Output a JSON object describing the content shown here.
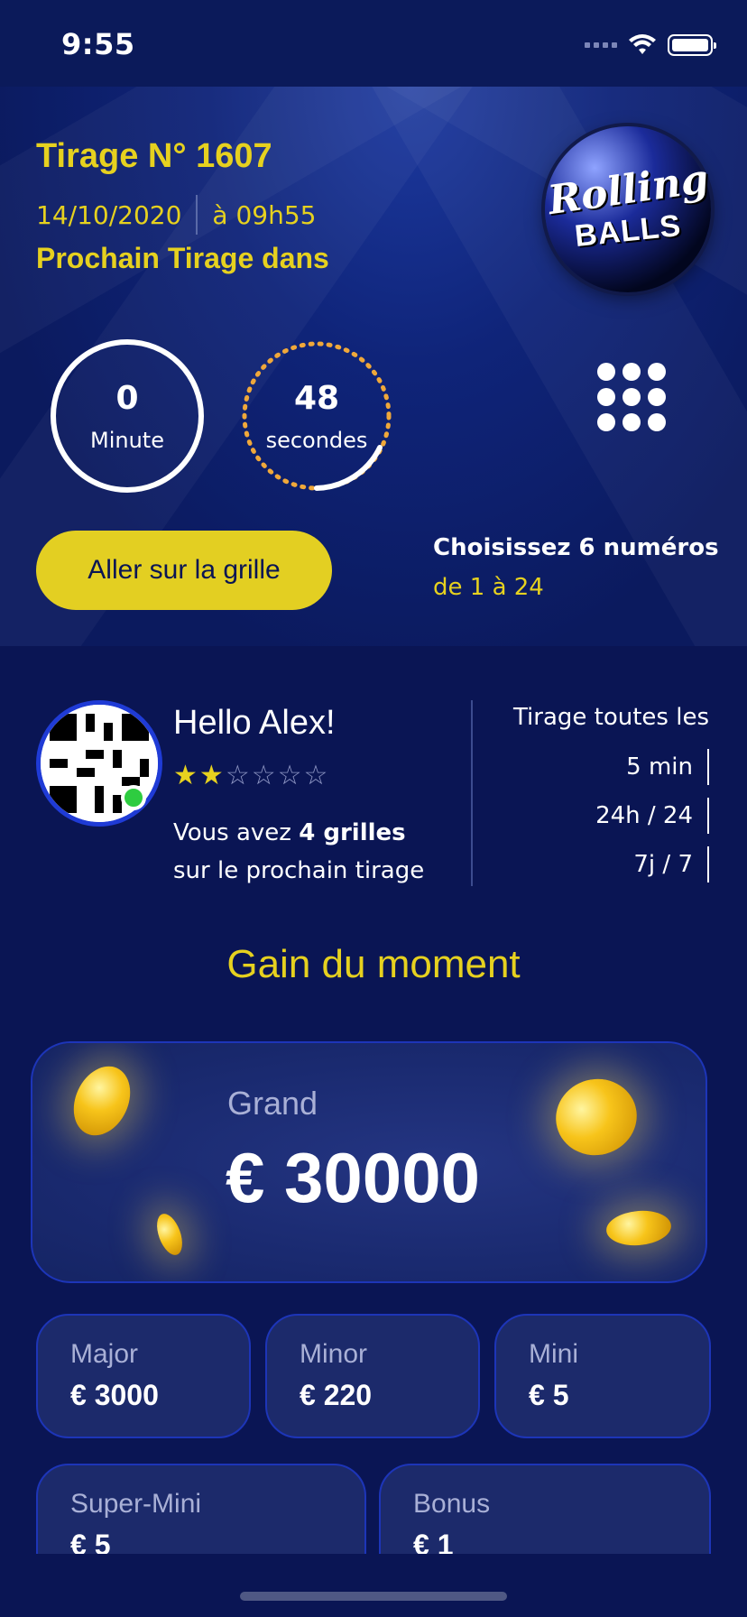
{
  "status_bar": {
    "time": "9:55"
  },
  "hero": {
    "title": "Tirage N° 1607",
    "date": "14/10/2020",
    "time": "à 09h55",
    "next_label": "Prochain Tirage dans",
    "logo_line1": "Rolling",
    "logo_line2": "BALLS",
    "timer": {
      "minutes_value": "0",
      "minutes_label": "Minute",
      "seconds_value": "48",
      "seconds_label": "secondes"
    },
    "grid_button_label": "Aller sur la grille",
    "choose_title": "Choisissez 6 numéros",
    "choose_range": "de 1 à 24"
  },
  "profile": {
    "greeting": "Hello Alex!",
    "rating": 2,
    "rating_max": 6,
    "grids_prefix": "Vous avez ",
    "grids_count": "4 grilles",
    "grids_suffix": "sur le prochain tirage",
    "draw_freq_title": "Tirage toutes les",
    "draw_freq_items": [
      "5 min",
      "24h / 24",
      "7j / 7"
    ]
  },
  "gain": {
    "title": "Gain du moment",
    "jackpot_label": "Grand",
    "jackpot_value": "€ 30000",
    "prizes": [
      {
        "label": "Major",
        "value": "€ 3000"
      },
      {
        "label": "Minor",
        "value": "€ 220"
      },
      {
        "label": "Mini",
        "value": "€ 5"
      },
      {
        "label": "Super-Mini",
        "value": "€ 5"
      },
      {
        "label": "Bonus",
        "value": "€ 1"
      }
    ]
  },
  "colors": {
    "background": "#0a1554",
    "accent_yellow": "#e6d11f",
    "card": "#1c2a6b",
    "timer_dots": "#f0a83a"
  }
}
